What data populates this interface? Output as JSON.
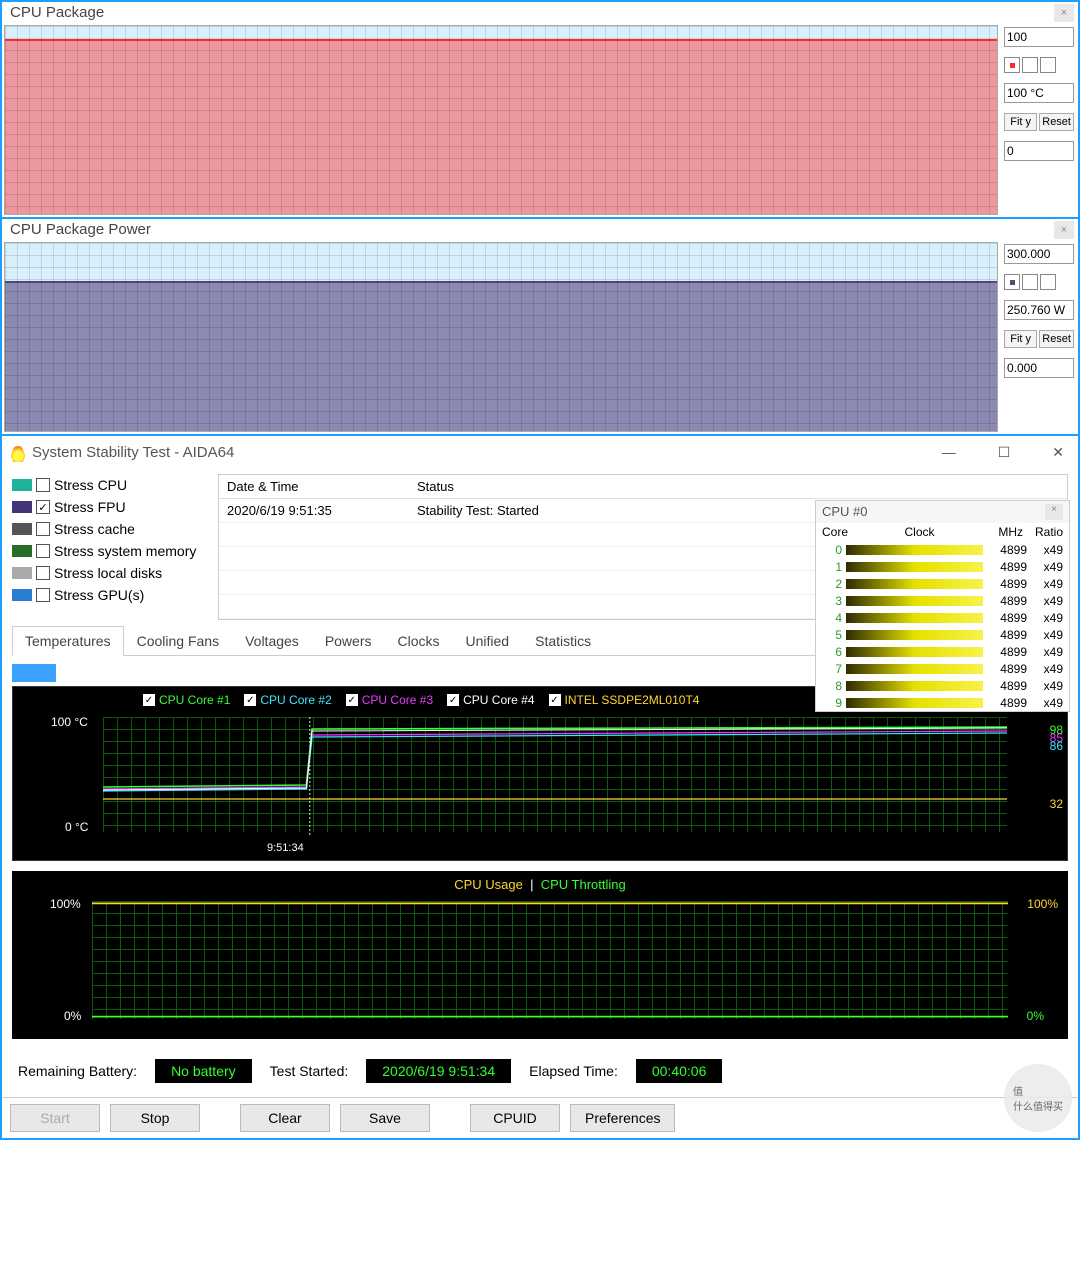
{
  "charts": [
    {
      "title": "CPU Package",
      "max": "100",
      "min": "0",
      "value": "100 °C",
      "buttons": [
        "Fit y",
        "Reset"
      ],
      "fill_top": 7,
      "fill_color": "rgba(255,80,80,.55)",
      "edge_color": "#ff2a2a",
      "swatch": "#ff2a2a"
    },
    {
      "title": "CPU Package Power",
      "max": "300.000",
      "min": "0.000",
      "value": "250.760 W",
      "buttons": [
        "Fit y",
        "Reset"
      ],
      "fill_top": 20,
      "fill_color": "rgba(97,83,140,.65)",
      "edge_color": "#5a457a",
      "swatch": "#5a457a"
    }
  ],
  "aida": {
    "title": "System Stability Test - AIDA64",
    "stress": [
      {
        "label": "Stress CPU",
        "checked": false
      },
      {
        "label": "Stress FPU",
        "checked": true
      },
      {
        "label": "Stress cache",
        "checked": false
      },
      {
        "label": "Stress system memory",
        "checked": false
      },
      {
        "label": "Stress local disks",
        "checked": false
      },
      {
        "label": "Stress GPU(s)",
        "checked": false
      }
    ],
    "status_head": [
      "Date & Time",
      "Status"
    ],
    "status_rows": [
      [
        "2020/6/19 9:51:35",
        "Stability Test: Started"
      ]
    ],
    "tabs": [
      "Temperatures",
      "Cooling Fans",
      "Voltages",
      "Powers",
      "Clocks",
      "Unified",
      "Statistics"
    ],
    "active_tab": 0
  },
  "cpu0": {
    "title": "CPU #0",
    "head": [
      "Core",
      "Clock",
      "MHz",
      "Ratio"
    ],
    "cores": [
      {
        "id": "0",
        "mhz": "4899",
        "ratio": "x49"
      },
      {
        "id": "1",
        "mhz": "4899",
        "ratio": "x49"
      },
      {
        "id": "2",
        "mhz": "4899",
        "ratio": "x49"
      },
      {
        "id": "3",
        "mhz": "4899",
        "ratio": "x49"
      },
      {
        "id": "4",
        "mhz": "4899",
        "ratio": "x49"
      },
      {
        "id": "5",
        "mhz": "4899",
        "ratio": "x49"
      },
      {
        "id": "6",
        "mhz": "4899",
        "ratio": "x49"
      },
      {
        "id": "7",
        "mhz": "4899",
        "ratio": "x49"
      },
      {
        "id": "8",
        "mhz": "4899",
        "ratio": "x49"
      },
      {
        "id": "9",
        "mhz": "4899",
        "ratio": "x49"
      }
    ]
  },
  "temp": {
    "legend": [
      {
        "label": "CPU Core #1",
        "color": "#36ff36"
      },
      {
        "label": "CPU Core #2",
        "color": "#36e7ff"
      },
      {
        "label": "CPU Core #3",
        "color": "#e83bff"
      },
      {
        "label": "CPU Core #4",
        "color": "#ffffff"
      },
      {
        "label": "INTEL SSDPE2ML010T4",
        "color": "#ffd633"
      }
    ],
    "y_hi": "100 °C",
    "y_lo": "0 °C",
    "x_time": "9:51:34",
    "vals": [
      {
        "v": "98",
        "c": "#36ff36"
      },
      {
        "v": "85",
        "c": "#e83bff"
      },
      {
        "v": "86",
        "c": "#36e7ff"
      },
      {
        "v": "32",
        "c": "#ffd633"
      }
    ]
  },
  "usage": {
    "labels": [
      "CPU Usage",
      "CPU Throttling"
    ],
    "l100": "100%",
    "l0": "0%",
    "r100": "100%",
    "r0": "0%"
  },
  "status": {
    "battery_label": "Remaining Battery:",
    "battery_val": "No battery",
    "started_label": "Test Started:",
    "started_val": "2020/6/19 9:51:34",
    "elapsed_label": "Elapsed Time:",
    "elapsed_val": "00:40:06"
  },
  "buttons": [
    "Start",
    "Stop",
    "Clear",
    "Save",
    "CPUID",
    "Preferences"
  ],
  "chart_data": [
    {
      "type": "line",
      "title": "CPU Package",
      "ylabel": "°C",
      "ylim": [
        0,
        100
      ],
      "series": [
        {
          "name": "CPU Package temperature",
          "approx": "flat near 100 °C across window"
        }
      ]
    },
    {
      "type": "line",
      "title": "CPU Package Power",
      "ylabel": "W",
      "ylim": [
        0,
        300
      ],
      "series": [
        {
          "name": "CPU Package Power",
          "approx": "flat near 250.76 W across window"
        }
      ]
    },
    {
      "type": "line",
      "title": "Temperatures",
      "ylabel": "°C",
      "ylim": [
        0,
        100
      ],
      "x_marker": "9:51:34",
      "series": [
        {
          "name": "CPU Core #1",
          "latest": 98
        },
        {
          "name": "CPU Core #2",
          "latest": 86
        },
        {
          "name": "CPU Core #3",
          "latest": 85
        },
        {
          "name": "CPU Core #4",
          "latest": 98
        },
        {
          "name": "INTEL SSDPE2ML010T4",
          "latest": 32
        }
      ]
    },
    {
      "type": "line",
      "title": "CPU Usage / Throttling",
      "ylabel": "%",
      "ylim": [
        0,
        100
      ],
      "series": [
        {
          "name": "CPU Usage",
          "latest": 100
        },
        {
          "name": "CPU Throttling",
          "latest": 0
        }
      ]
    }
  ]
}
